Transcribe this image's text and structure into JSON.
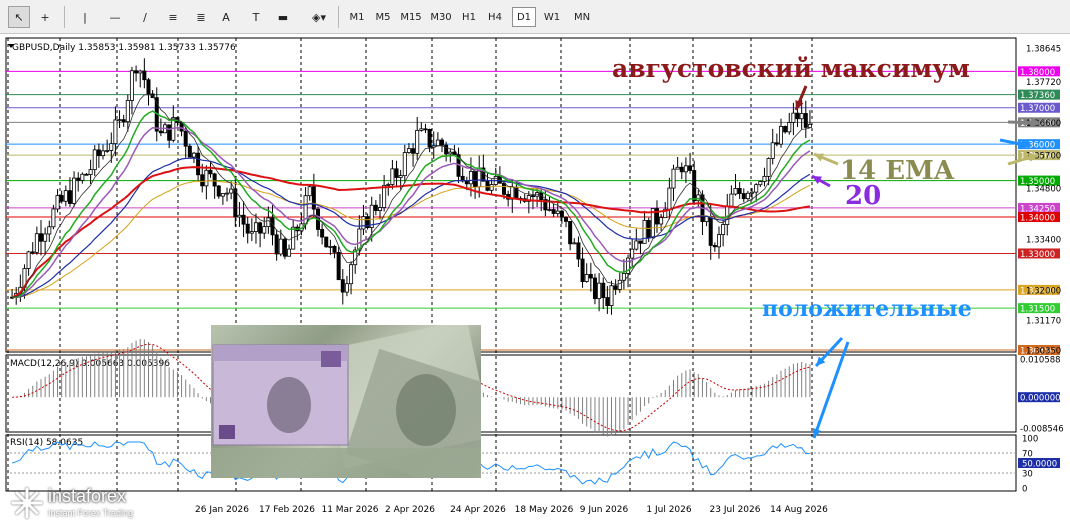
{
  "toolbar": {
    "tools": [
      {
        "name": "cursor-tool",
        "glyph": "↖"
      },
      {
        "name": "crosshair-tool",
        "glyph": "+"
      },
      {
        "name": "vertical-line-tool",
        "glyph": "|"
      },
      {
        "name": "horizontal-line-tool",
        "glyph": "—"
      },
      {
        "name": "trendline-tool",
        "glyph": "∕"
      },
      {
        "name": "channel-tool",
        "glyph": "≡"
      },
      {
        "name": "fibonacci-tool",
        "glyph": "≣"
      },
      {
        "name": "text-tool",
        "glyph": "A"
      },
      {
        "name": "text-label-tool",
        "glyph": "T"
      },
      {
        "name": "rectangle-tool",
        "glyph": "▬"
      },
      {
        "name": "shapes-tool",
        "glyph": "◈▾"
      }
    ],
    "timeframes": [
      "M1",
      "M5",
      "M15",
      "M30",
      "H1",
      "H4",
      "D1",
      "W1",
      "MN"
    ],
    "active_timeframe": "D1"
  },
  "chart_data": {
    "type": "candlestick",
    "title": "GBPUSD,Daily  1.35853 1.35981 1.35733 1.35776",
    "symbol": "GBPUSD",
    "timeframe": "Daily",
    "ohlc_last": {
      "open": 1.35853,
      "high": 1.35981,
      "low": 1.35733,
      "close": 1.35776
    },
    "x_tick_labels": [
      "26 Jan 2026",
      "17 Feb 2026",
      "11 Mar 2026",
      "2 Apr 2026",
      "24 Apr 2026",
      "18 May 2026",
      "9 Jun 2026",
      "1 Jul 2026",
      "23 Jul 2026",
      "14 Aug 2026"
    ],
    "ylim": [
      1.3035,
      1.3864
    ],
    "y_tick_labels": [
      "1.38645",
      "1.37720",
      "1.36600",
      "1.35700",
      "1.34800",
      "1.33400",
      "1.32000",
      "1.31170",
      "1.30350"
    ],
    "levels": [
      {
        "value": 1.38,
        "label": "1.38000",
        "color": "#ee00ee"
      },
      {
        "value": 1.3736,
        "label": "1.37360",
        "color": "#2e8b57"
      },
      {
        "value": 1.37,
        "label": "1.37000",
        "color": "#6a5acd"
      },
      {
        "value": 1.366,
        "label": "1.36600",
        "color": "#7f7f7f"
      },
      {
        "value": 1.36,
        "label": "1.36000",
        "color": "#1e90ff"
      },
      {
        "value": 1.357,
        "label": "1.35700",
        "color": "#bdb76b"
      },
      {
        "value": 1.35,
        "label": "1.35000",
        "color": "#00aa00"
      },
      {
        "value": 1.3425,
        "label": "1.34250",
        "color": "#cc44cc"
      },
      {
        "value": 1.34,
        "label": "1.34000",
        "color": "#dd0000"
      },
      {
        "value": 1.33,
        "label": "1.33000",
        "color": "#cc2222"
      },
      {
        "value": 1.32,
        "label": "1.32000",
        "color": "#daa520"
      },
      {
        "value": 1.315,
        "label": "1.31500",
        "color": "#32cd32"
      },
      {
        "value": 1.3035,
        "label": "1.30350",
        "color": "#d2691e"
      }
    ],
    "indicators": {
      "macd": {
        "label": "MACD(12,26,9) 0.005663 0.005396",
        "ylim": [
          -0.008546,
          0.010588
        ],
        "y_tick_labels": [
          "0.010588",
          "0.000000",
          "-0.008546"
        ]
      },
      "rsi": {
        "label": "RSI(14) 58.0635",
        "ylim": [
          0,
          100
        ],
        "y_tick_labels": [
          "100",
          "70",
          "50.0000",
          "30",
          "0"
        ]
      }
    },
    "annotations": [
      {
        "text": "августовский максимум",
        "color": "#8b1a1a"
      },
      {
        "text": "14 EMA",
        "color": "#8b8b50"
      },
      {
        "text": "20",
        "color": "#8a2be2"
      },
      {
        "text": "положительные",
        "color": "#1e90ff"
      }
    ]
  },
  "watermark": {
    "brand": "instaforex",
    "tagline": "Instant Forex Trading"
  }
}
